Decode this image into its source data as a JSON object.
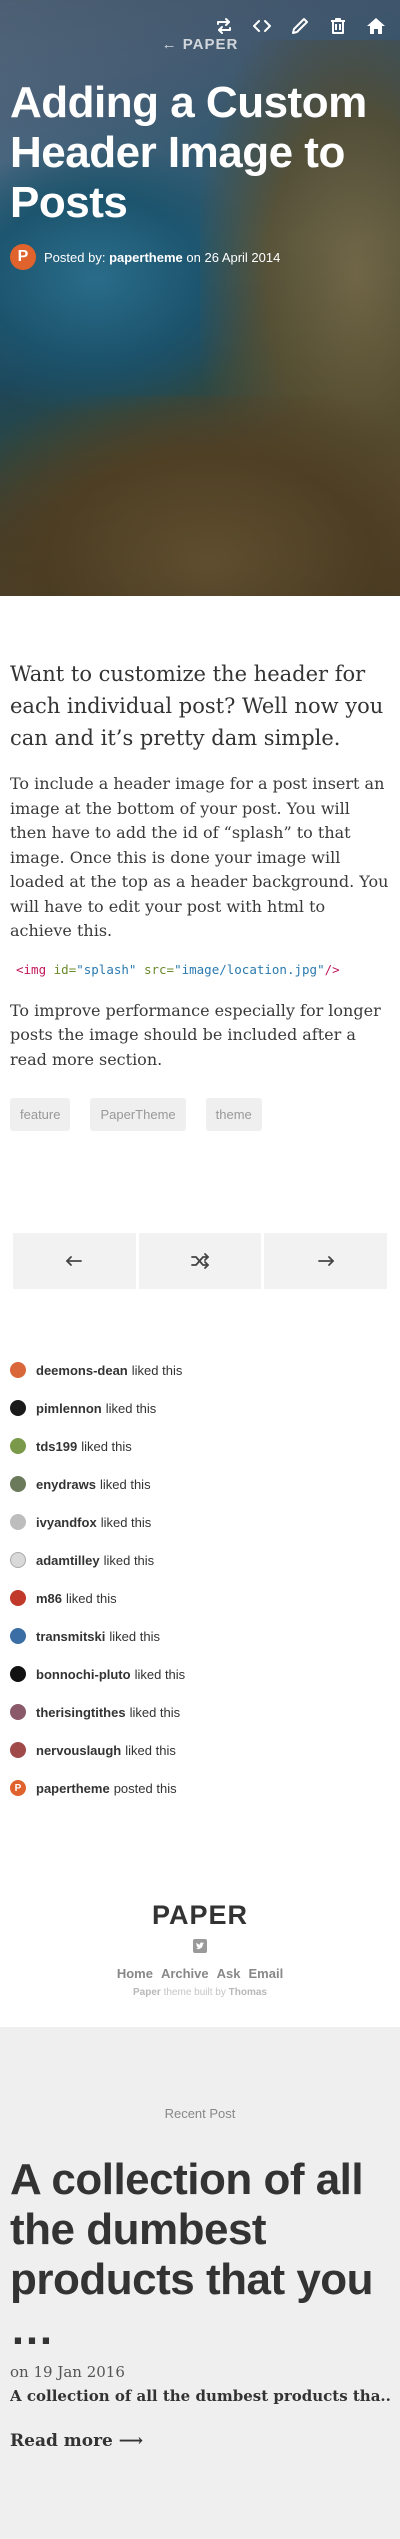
{
  "header": {
    "back_label": "← PAPER",
    "title": "Adding a Custom Header Image to Posts",
    "author_initial": "P",
    "byline_prefix": "Posted by:",
    "author": "papertheme",
    "date_text": "on 26 April 2014",
    "toolbar": [
      "reblog-icon",
      "code-icon",
      "edit-icon",
      "delete-icon",
      "home-icon"
    ]
  },
  "post": {
    "lead": "Want to customize the header for each individual post? Well now you can and it’s pretty dam simple.",
    "para1": "To include a header image for a post insert an image at the bottom of your post. You will then have to add the id of “splash” to that image. Once this is done your image will loaded at the top as a header background. You will have to edit your post with html to achieve this.",
    "code": {
      "open": "<img",
      "id_attr": "id=",
      "id_val": "\"splash\"",
      "src_attr": "src=",
      "src_val": "\"image/location.jpg\"",
      "close": "/>"
    },
    "para2": "To improve performance especially for longer posts the image should be included after a read more section.",
    "tags": [
      "feature",
      "PaperTheme",
      "theme"
    ]
  },
  "pager": {
    "prev": "prev-arrow-icon",
    "random": "shuffle-icon",
    "next": "next-arrow-icon"
  },
  "notes": [
    {
      "user": "deemons-dean",
      "action": "liked this",
      "color": "#d9673a"
    },
    {
      "user": "pimlennon",
      "action": "liked this",
      "color": "#1a1a1a"
    },
    {
      "user": "tds199",
      "action": "liked this",
      "color": "#7a9a4a"
    },
    {
      "user": "enydraws",
      "action": "liked this",
      "color": "#6a7a5a"
    },
    {
      "user": "ivyandfox",
      "action": "liked this",
      "color": "#bdbdbd"
    },
    {
      "user": "adamtilley",
      "action": "liked this",
      "color": "#d9d9d9"
    },
    {
      "user": "m86",
      "action": "liked this",
      "color": "#c0392b"
    },
    {
      "user": "transmitski",
      "action": "liked this",
      "color": "#3b6ea5"
    },
    {
      "user": "bonnochi-pluto",
      "action": "liked this",
      "color": "#111111"
    },
    {
      "user": "therisingtithes",
      "action": "liked this",
      "color": "#8a5a6a"
    },
    {
      "user": "nervouslaugh",
      "action": "liked this",
      "color": "#a04a4a"
    },
    {
      "user": "papertheme",
      "action": "posted this",
      "color": "#e0632d",
      "initial": "P"
    }
  ],
  "footer": {
    "brand": "PAPER",
    "links": [
      "Home",
      "Archive",
      "Ask",
      "Email"
    ],
    "credit_theme": "Paper",
    "credit_mid": "theme built by",
    "credit_author": "Thomas"
  },
  "recent": {
    "label": "Recent Post",
    "title": "A collection of all the dumbest products that you …",
    "date": "on 19 Jan 2016",
    "summary": "A collection of all the dumbest products tha...",
    "more": "Read more ⟶"
  }
}
